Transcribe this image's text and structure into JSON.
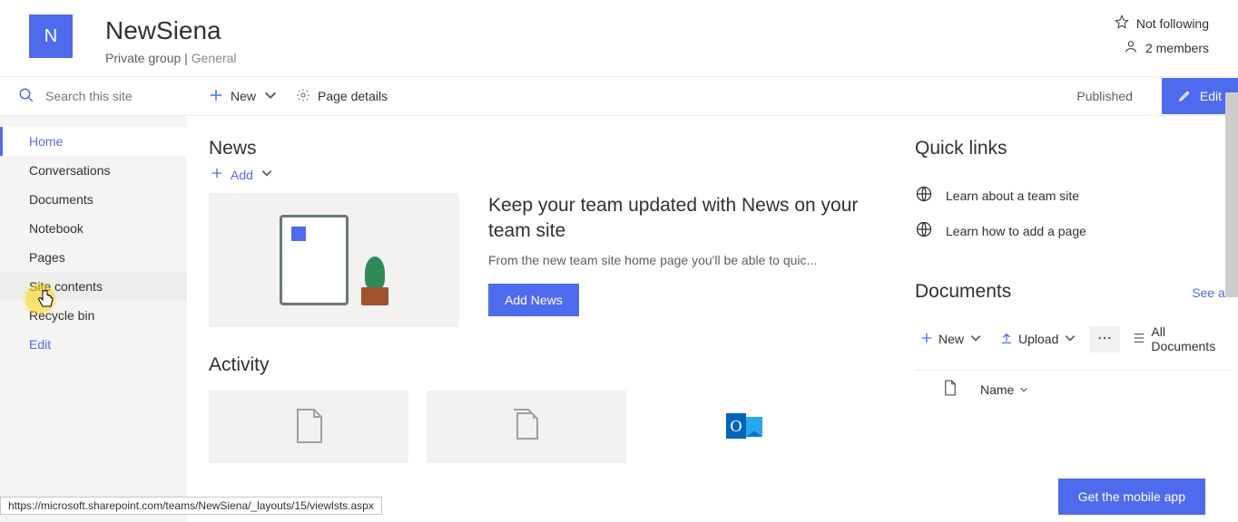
{
  "header": {
    "logo_letter": "N",
    "title": "NewSiena",
    "group_type": "Private group",
    "divider": " | ",
    "channel": "General",
    "not_following": "Not following",
    "members": "2 members"
  },
  "search": {
    "placeholder": "Search this site"
  },
  "toolbar": {
    "new_label": "New",
    "page_details": "Page details",
    "published": "Published",
    "edit": "Edit"
  },
  "nav": {
    "items": [
      {
        "label": "Home",
        "active": true
      },
      {
        "label": "Conversations"
      },
      {
        "label": "Documents"
      },
      {
        "label": "Notebook"
      },
      {
        "label": "Pages"
      },
      {
        "label": "Site contents",
        "hover": true
      },
      {
        "label": "Recycle bin"
      },
      {
        "label": "Edit",
        "edit": true
      }
    ]
  },
  "news": {
    "section": "News",
    "add": "Add",
    "heading": "Keep your team updated with News on your team site",
    "desc": "From the new team site home page you'll be able to quic...",
    "button": "Add News"
  },
  "activity": {
    "section": "Activity"
  },
  "quicklinks": {
    "section": "Quick links",
    "items": [
      {
        "label": "Learn about a team site"
      },
      {
        "label": "Learn how to add a page"
      }
    ]
  },
  "documents": {
    "section": "Documents",
    "see_all": "See all",
    "new": "New",
    "upload": "Upload",
    "all_documents": "All Documents",
    "name_col": "Name"
  },
  "mobile": {
    "label": "Get the mobile app"
  },
  "status_url": "https://microsoft.sharepoint.com/teams/NewSiena/_layouts/15/viewlsts.aspx"
}
